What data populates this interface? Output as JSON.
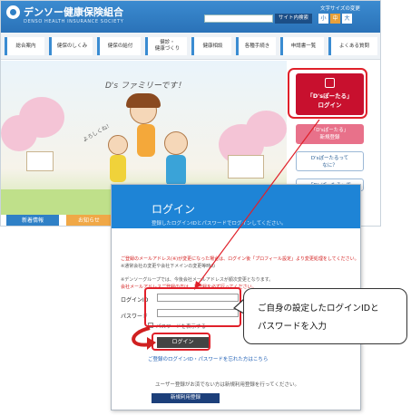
{
  "header": {
    "logo_jp": "デンソー健康保険組合",
    "logo_en": "DENSO HEALTH INSURANCE SOCIETY",
    "search_button": "サイト内検索",
    "font_size_label": "文字サイズの変更",
    "font_sizes": [
      "小",
      "中",
      "大"
    ]
  },
  "nav": {
    "items": [
      {
        "label": "総合案内"
      },
      {
        "label": "健保のしくみ"
      },
      {
        "label": "健保の給付"
      },
      {
        "label": "健診・\n健康づくり"
      },
      {
        "label": "健康相談"
      },
      {
        "label": "各種手続き"
      },
      {
        "label": "申請書一覧"
      },
      {
        "label": "よくある質問"
      }
    ]
  },
  "hero": {
    "banner": "D's ファミリーです！",
    "greeting": "よろしくね！"
  },
  "sidebar": {
    "login_line1": "「D'sぽーたる」",
    "login_line2": "ログイン",
    "register": "「D'sぽーたる」\n新規登録",
    "about": "D'sぽーたるって\nなに？",
    "more": "「D'sぽーたる」で"
  },
  "tabs": {
    "news": "新着情報",
    "notice": "お知らせ"
  },
  "dialog": {
    "title": "ログイン",
    "subtitle": "登録したログインIDとパスワードでログインしてください。",
    "notice_red_1": "ご登録のメールアドレス(※)が変更になった場合は、ログイン後「プロフィール設定」より変更処理をしてください。",
    "notice_gray_1": "※通常会社の変更や会社下メインの変更等時の",
    "notice_gray_2": "※デンソーグループでは、今後会社メールアドレスが順次変更となります。",
    "notice_red_2": "会社メールアドレスご登録の方は、ご登録を必ず行ってください。",
    "login_id_label": "ログインID",
    "password_label": "パスワード",
    "show_password": "パスワードを表示する",
    "login_button": "ログイン",
    "forgot_link": "ご登録のログインID・パスワードを忘れた方はこちら",
    "register_note": "ユーザー登録がお済でない方は新規利用登録を行ってください。",
    "new_register_button": "新規利用登録"
  },
  "callout": {
    "line1": "ご自身の設定したログインIDと",
    "line2": "パスワードを入力"
  },
  "colors": {
    "header_blue": "#2f80c6",
    "dialog_blue": "#1e84d6",
    "login_red": "#c8102e",
    "highlight_red": "#e0202a"
  }
}
